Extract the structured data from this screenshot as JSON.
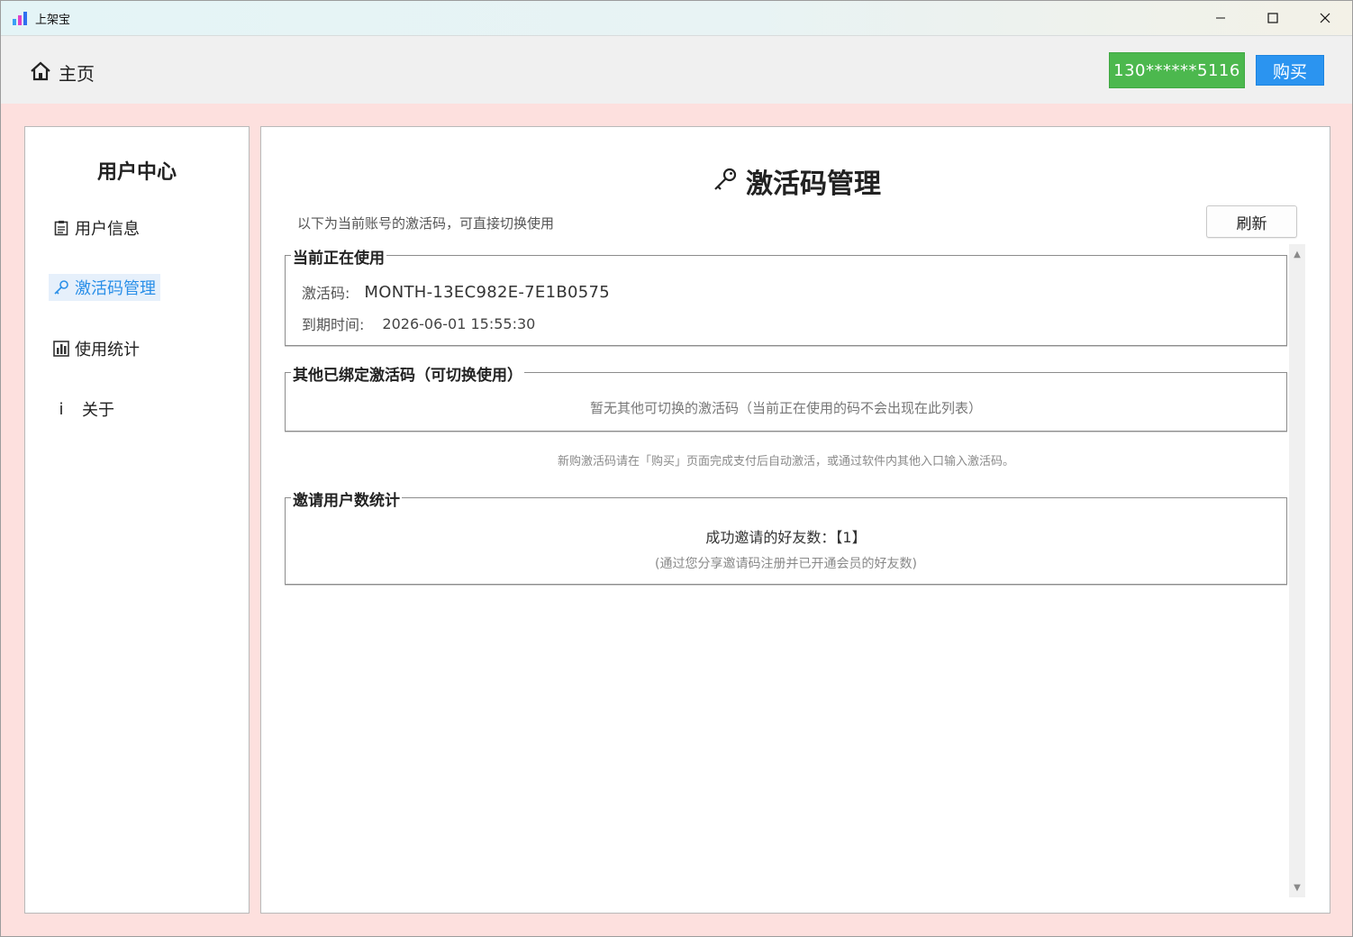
{
  "window": {
    "title": "上架宝",
    "controls": {
      "minimize_icon": "minimize-icon",
      "maximize_icon": "maximize-icon",
      "close_icon": "close-icon"
    }
  },
  "header": {
    "home_label": "主页",
    "home_icon": "home-icon",
    "account": "130******5116",
    "buy_label": "购买",
    "account_color": "#4cb84e",
    "buy_color": "#2b94f0"
  },
  "sidebar": {
    "title": "用户中心",
    "items": [
      {
        "label": "用户信息",
        "icon": "clipboard-icon",
        "active": false
      },
      {
        "label": "激活码管理",
        "icon": "key-icon",
        "active": true
      },
      {
        "label": "使用统计",
        "icon": "bar-chart-icon",
        "active": false
      },
      {
        "label": "关于",
        "icon": "info-icon",
        "icon_text": "i",
        "active": false
      }
    ],
    "active_color": "#2a8fe8"
  },
  "main": {
    "title": "激活码管理",
    "title_icon": "key-icon",
    "subtitle": "以下为当前账号的激活码，可直接切换使用",
    "refresh_label": "刷新",
    "current": {
      "legend": "当前正在使用",
      "code_label": "激活码:",
      "code_value": "MONTH-13EC982E-7E1B0575",
      "expire_label": "到期时间:",
      "expire_value": "2026-06-01 15:55:30"
    },
    "others": {
      "legend": "其他已绑定激活码（可切换使用）",
      "empty_hint": "暂无其他可切换的激活码（当前正在使用的码不会出现在此列表）"
    },
    "purchase_note": "新购激活码请在「购买」页面完成支付后自动激活，或通过软件内其他入口输入激活码。",
    "invite": {
      "legend": "邀请用户数统计",
      "count_text": "成功邀请的好友数：【1】",
      "note": "(通过您分享邀请码注册并已开通会员的好友数)"
    }
  }
}
